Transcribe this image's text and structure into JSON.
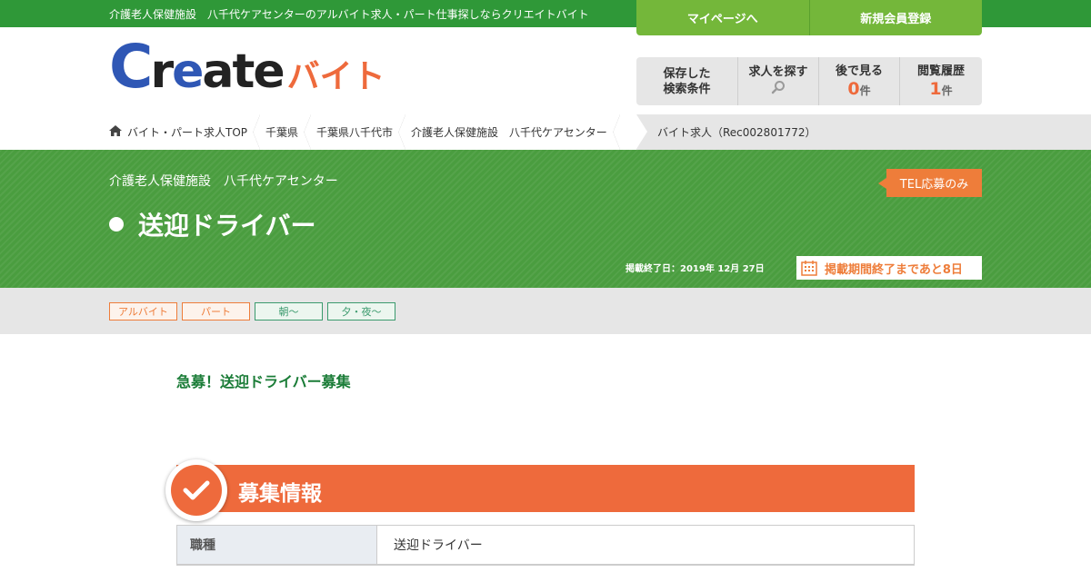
{
  "header": {
    "tagline": "介護老人保健施設　八千代ケアセンターのアルバイト求人・パート仕事探しならクリエイトバイト",
    "mypage_label": "マイページへ",
    "register_label": "新規会員登録",
    "logo": {
      "part1": "C",
      "part2": "r",
      "part3": "e",
      "part4": "ate",
      "part5": "バイト"
    }
  },
  "tools": {
    "saved_search_line1": "保存した",
    "saved_search_line2": "検索条件",
    "find_jobs_label": "求人を探す",
    "later_label": "後で見る",
    "later_count": "0",
    "history_label": "閲覧履歴",
    "history_count": "1",
    "unit": "件"
  },
  "breadcrumb": {
    "items": [
      {
        "label": "バイト・パート求人TOP"
      },
      {
        "label": "千葉県"
      },
      {
        "label": "千葉県八千代市"
      },
      {
        "label": "介護老人保健施設　八千代ケアセンター"
      }
    ],
    "current": "バイト求人（Rec002801772）"
  },
  "job": {
    "company": "介護老人保健施設　八千代ケアセンター",
    "title": "送迎ドライバー",
    "tel_badge": "TEL応募のみ",
    "end_date": "掲載終了日：2019年 12月 27日",
    "remaining": "掲載期間終了まであと8日",
    "tags": [
      "アルバイト",
      "パート",
      "朝～",
      "夕・夜～"
    ],
    "catch_copy": "急募！送迎ドライバー募集"
  },
  "recruit_section": {
    "heading": "募集情報",
    "rows": [
      {
        "label": "職種",
        "value": "送迎ドライバー"
      }
    ]
  },
  "colors": {
    "brand_green": "#2f9838",
    "accent_orange": "#ee6a3c",
    "logo_blue": "#2f57b5"
  }
}
